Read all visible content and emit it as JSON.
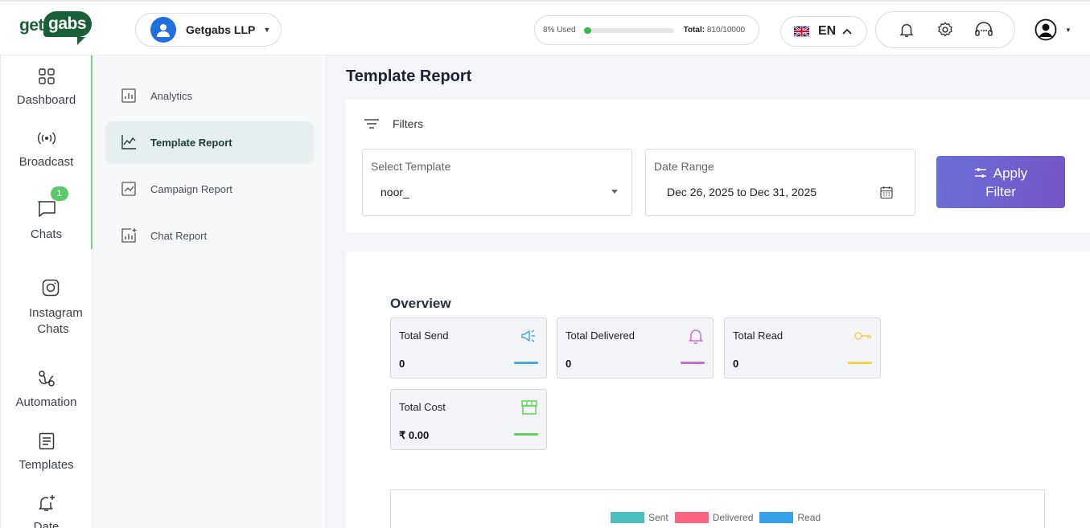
{
  "brand": {
    "logo_left": "get",
    "logo_right": "gabs"
  },
  "header": {
    "org_name": "Getgabs LLP",
    "usage_label": "8% Used",
    "usage_percent": 8,
    "total_label": "Total:",
    "total_value": "810/10000",
    "language": "EN"
  },
  "rail": {
    "items": [
      {
        "label": "Dashboard",
        "icon": "grid-icon"
      },
      {
        "label": "Broadcast",
        "icon": "broadcast-icon"
      },
      {
        "label": "Chats",
        "icon": "chat-bubble-icon",
        "badge": "1"
      },
      {
        "label": "Instagram Chats",
        "icon": "instagram-icon"
      },
      {
        "label": "Automation",
        "icon": "automation-icon"
      },
      {
        "label": "Templates",
        "icon": "document-icon"
      },
      {
        "label": "Date",
        "icon": "bell-plus-icon"
      }
    ]
  },
  "submenu": {
    "items": [
      {
        "label": "Analytics",
        "icon": "bar-chart-icon"
      },
      {
        "label": "Template Report",
        "icon": "line-chart-icon",
        "active": true
      },
      {
        "label": "Campaign Report",
        "icon": "trend-chart-icon"
      },
      {
        "label": "Chat Report",
        "icon": "chart-plus-icon"
      }
    ]
  },
  "main": {
    "title": "Template Report",
    "filters_label": "Filters",
    "template_field": {
      "label": "Select Template",
      "value": "noor_"
    },
    "date_field": {
      "label": "Date Range",
      "value": "Dec 26, 2025 to Dec 31, 2025"
    },
    "apply_label": "Apply Filter",
    "overview_title": "Overview",
    "stats": [
      {
        "title": "Total Send",
        "value": "0",
        "color": "#4aa8e0",
        "icon": "megaphone-icon"
      },
      {
        "title": "Total Delivered",
        "value": "0",
        "color": "#c56fd6",
        "icon": "bell-icon"
      },
      {
        "title": "Total Read",
        "value": "0",
        "color": "#f2d34a",
        "icon": "key-icon"
      },
      {
        "title": "Total Cost",
        "value": "₹ 0.00",
        "color": "#5ed45e",
        "icon": "store-icon"
      }
    ]
  },
  "chart_data": {
    "type": "bar",
    "series": [
      {
        "name": "Sent",
        "color": "#4bc0c0"
      },
      {
        "name": "Delivered",
        "color": "#ff6384"
      },
      {
        "name": "Read",
        "color": "#36a2eb"
      }
    ]
  }
}
